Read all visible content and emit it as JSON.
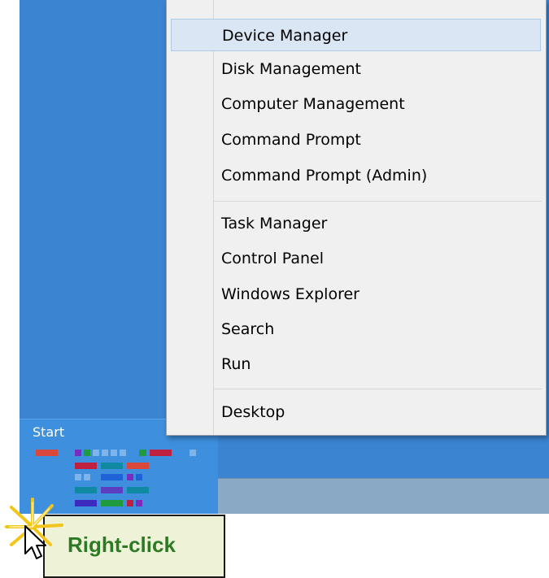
{
  "start": {
    "label": "Start"
  },
  "menu": {
    "items": [
      {
        "label": "Device Manager",
        "active": true
      },
      {
        "label": "Disk Management"
      },
      {
        "label": "Computer Management"
      },
      {
        "label": "Command Prompt"
      },
      {
        "label": "Command Prompt (Admin)"
      },
      {
        "label": "Task Manager"
      },
      {
        "label": "Control Panel"
      },
      {
        "label": "Windows Explorer"
      },
      {
        "label": "Search"
      },
      {
        "label": "Run"
      },
      {
        "label": "Desktop"
      }
    ]
  },
  "callout": {
    "text": "Right-click"
  },
  "colors": {
    "desktop": "#3a84d2",
    "menu_bg": "#f0f0f0",
    "highlight": "#dbe6f4",
    "callout_text": "#2d7a24"
  }
}
